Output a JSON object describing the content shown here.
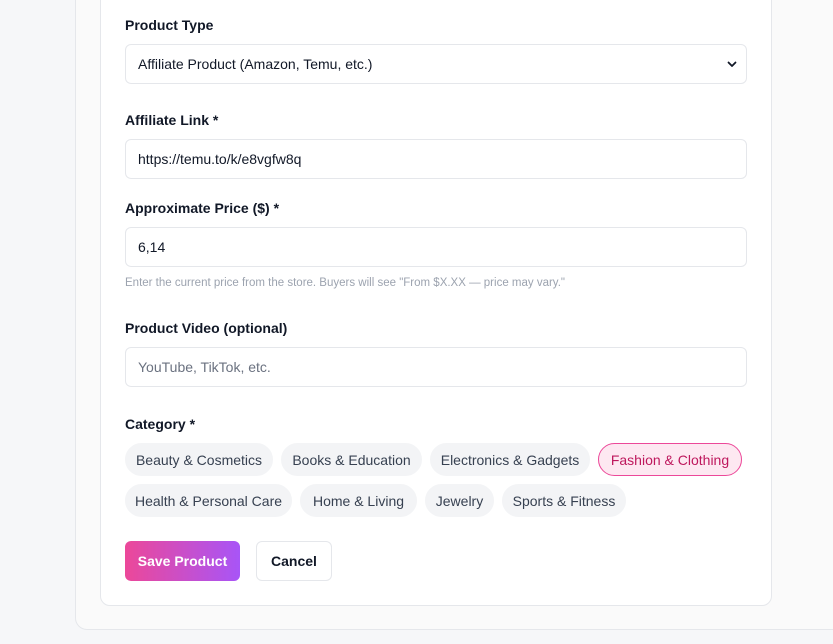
{
  "form": {
    "product_type": {
      "label": "Product Type",
      "selected": "Affiliate Product (Amazon, Temu, etc.)"
    },
    "affiliate_link": {
      "label": "Affiliate Link *",
      "value": "https://temu.to/k/e8vgfw8q"
    },
    "price": {
      "label": "Approximate Price ($) *",
      "value": "6,14",
      "hint": "Enter the current price from the store. Buyers will see \"From $X.XX — price may vary.\""
    },
    "video": {
      "label": "Product Video (optional)",
      "placeholder": "YouTube, TikTok, etc."
    },
    "category": {
      "label": "Category *",
      "options": [
        {
          "label": "Beauty & Cosmetics",
          "selected": false
        },
        {
          "label": "Books & Education",
          "selected": false
        },
        {
          "label": "Electronics & Gadgets",
          "selected": false
        },
        {
          "label": "Fashion & Clothing",
          "selected": true
        },
        {
          "label": "Health & Personal Care",
          "selected": false
        },
        {
          "label": "Home & Living",
          "selected": false
        },
        {
          "label": "Jewelry",
          "selected": false
        },
        {
          "label": "Sports & Fitness",
          "selected": false
        }
      ]
    },
    "actions": {
      "save_label": "Save Product",
      "cancel_label": "Cancel"
    }
  },
  "icons": {
    "select_chevron": "chevron-down-icon"
  },
  "colors": {
    "accent_start": "#ec4899",
    "accent_end": "#a855f7",
    "selected_chip_bg": "#fde8f1",
    "selected_chip_text": "#be185d"
  }
}
